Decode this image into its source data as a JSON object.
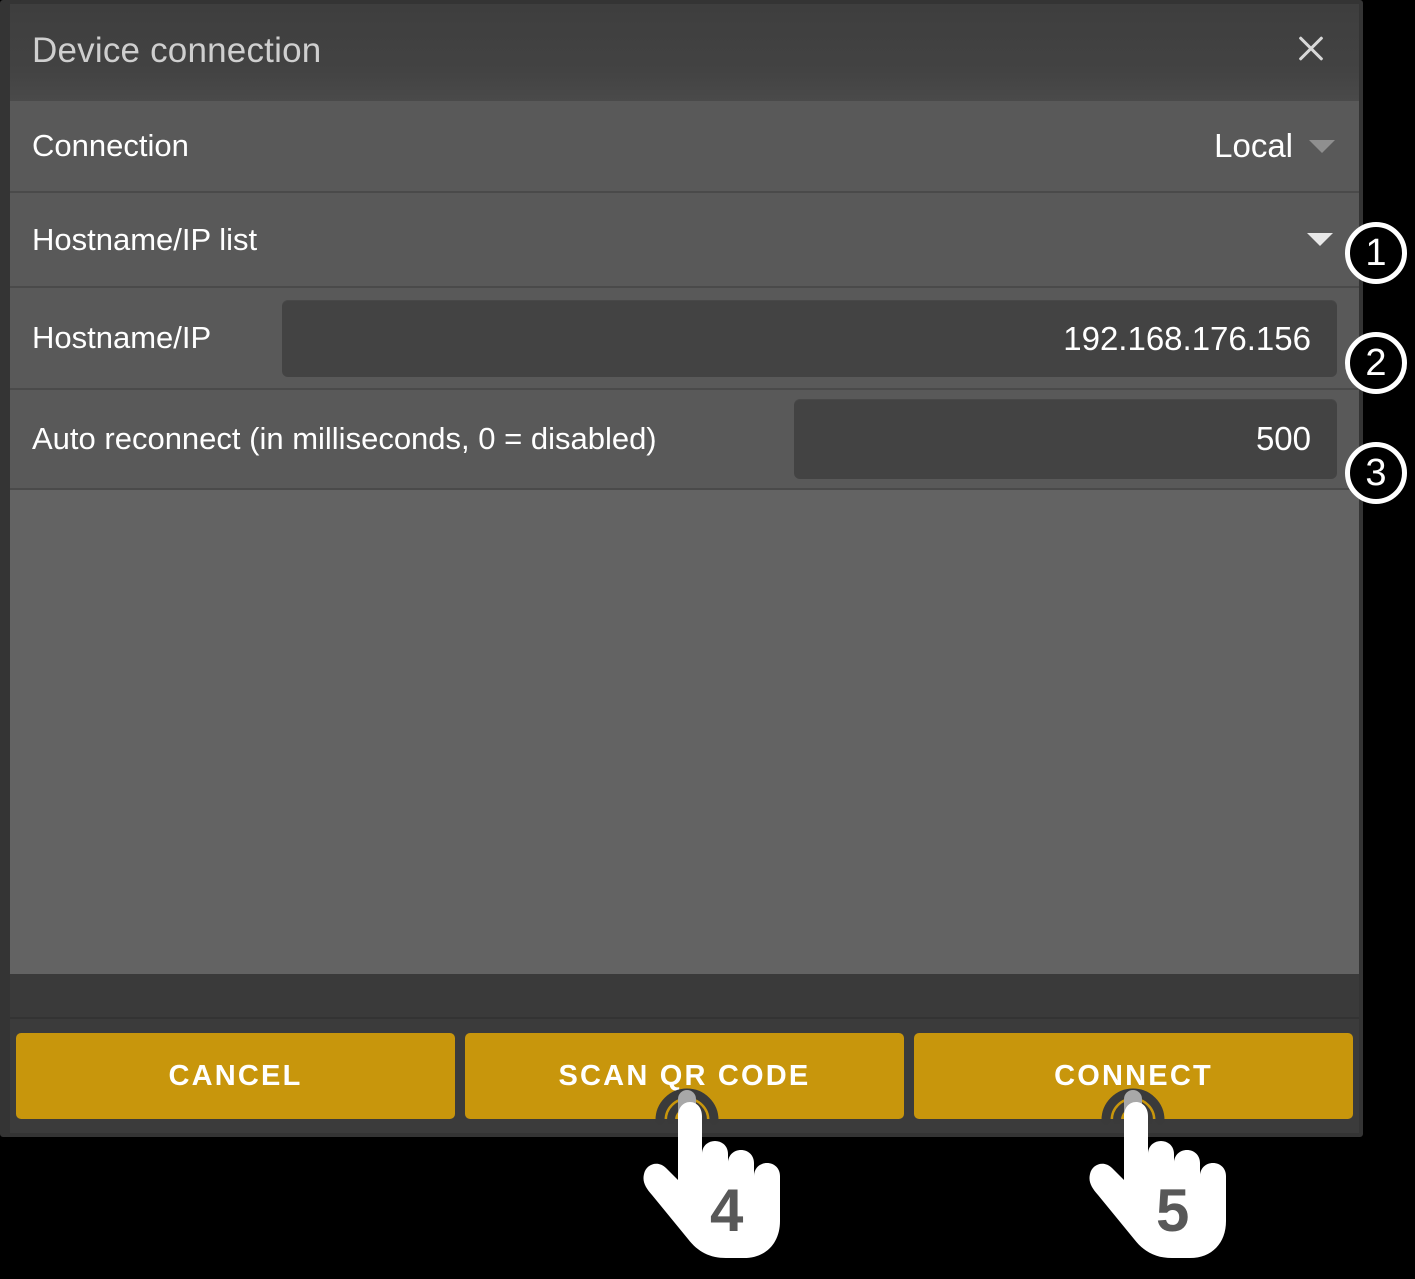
{
  "dialog": {
    "title": "Device connection",
    "close_icon": "close-icon"
  },
  "rows": {
    "connection": {
      "label": "Connection",
      "value": "Local",
      "caret_icon": "chevron-down-icon"
    },
    "hostname_ip_list": {
      "label": "Hostname/IP list",
      "caret_icon": "chevron-down-icon",
      "step": "1"
    },
    "hostname_ip": {
      "label": "Hostname/IP",
      "value": "192.168.176.156",
      "step": "2"
    },
    "auto_reconnect": {
      "label": "Auto reconnect (in milliseconds, 0 = disabled)",
      "value": "500",
      "step": "3"
    }
  },
  "footer": {
    "cancel_label": "CANCEL",
    "scan_qr_label": "SCAN QR CODE",
    "connect_label": "CONNECT"
  },
  "annotations": {
    "step_1": "1",
    "step_2": "2",
    "step_3": "3",
    "tap_4": "4",
    "tap_5": "5"
  },
  "colors": {
    "accent": "#c8960c",
    "dialog_bg": "#3a3a3a",
    "row_bg": "#595959",
    "field_bg": "#434343",
    "body_bg": "#636363",
    "text": "#ffffff"
  }
}
